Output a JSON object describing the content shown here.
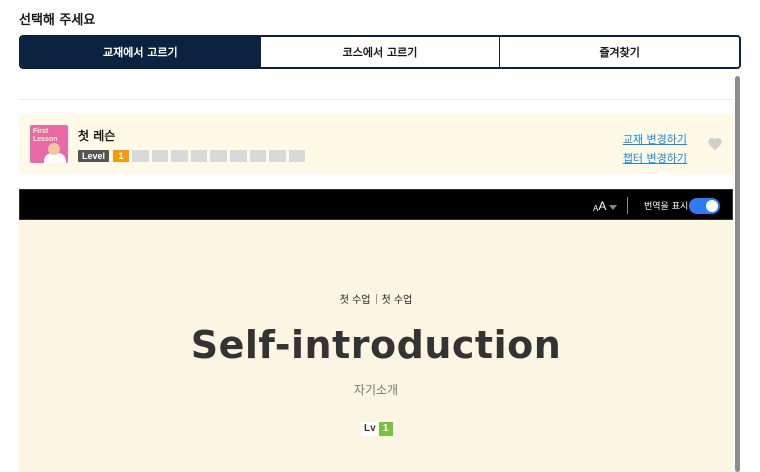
{
  "prompt": "선택해 주세요",
  "tabs": [
    {
      "label": "교재에서 고르기",
      "active": true
    },
    {
      "label": "코스에서 고르기",
      "active": false
    },
    {
      "label": "즐겨찾기",
      "active": false
    }
  ],
  "lesson_card": {
    "thumbnail_text": "First Lesson",
    "title": "첫 레슨",
    "level_label": "Level",
    "level_value": "1",
    "level_total": 10,
    "change_book_link": "교재 변경하기",
    "change_chapter_link": "챕터 변경하기",
    "favorite_icon": "heart-icon"
  },
  "viewer": {
    "font_size_icon_small": "A",
    "font_size_icon_big": "A",
    "translate_label": "번역을 표시",
    "translate_on": true,
    "breadcrumb": [
      "첫 수업",
      "첫 수업"
    ],
    "heading": "Self-introduction",
    "subtitle": "자기소개",
    "lv_label": "Lv",
    "lv_value": "1"
  },
  "colors": {
    "tab_active": "#0b2341",
    "level_accent": "#f29b13",
    "link": "#1a8ad8",
    "toggle": "#2f7bf6",
    "lv_badge": "#7bc043",
    "card_bg": "#fff9e8",
    "viewer_bg": "#fdf5e3"
  }
}
